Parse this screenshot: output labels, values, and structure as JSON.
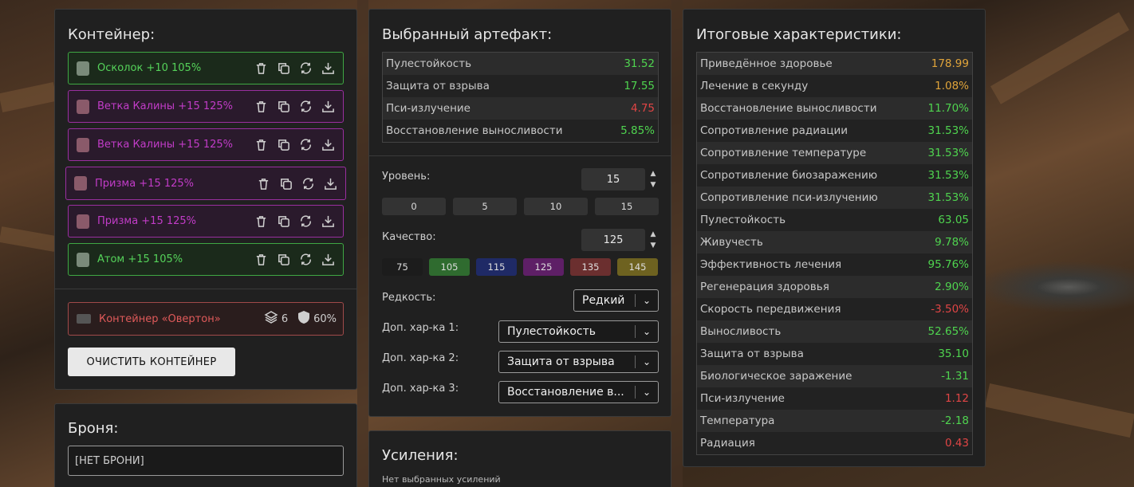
{
  "container": {
    "title": "Контейнер:",
    "items": [
      {
        "name": "Осколок +10 105%",
        "tier": "green"
      },
      {
        "name": "Ветка Калины +15 125%",
        "tier": "purple"
      },
      {
        "name": "Ветка Калины +15 125%",
        "tier": "purple"
      },
      {
        "name": "Призма +15 125%",
        "tier": "purple"
      },
      {
        "name": "Призма +15 125%",
        "tier": "purple"
      },
      {
        "name": "Атом +15 105%",
        "tier": "green"
      }
    ],
    "box": {
      "name": "Контейнер «Овертон»",
      "slots": "6",
      "protection": "60%"
    },
    "clear_label": "ОЧИСТИТЬ КОНТЕЙНЕР"
  },
  "armor": {
    "title": "Броня:",
    "value": "[НЕТ БРОНИ]"
  },
  "artifact": {
    "title": "Выбранный артефакт:",
    "stats": [
      {
        "label": "Пулестойкость",
        "value": "31.52",
        "color": "green"
      },
      {
        "label": "Защита от взрыва",
        "value": "17.55",
        "color": "green"
      },
      {
        "label": "Пси-излучение",
        "value": "4.75",
        "color": "red"
      },
      {
        "label": "Восстановление выносливости",
        "value": "5.85%",
        "color": "green"
      }
    ],
    "level_label": "Уровень:",
    "level_value": "15",
    "level_presets": [
      "0",
      "5",
      "10",
      "15"
    ],
    "quality_label": "Качество:",
    "quality_value": "125",
    "quality_presets": [
      {
        "label": "75",
        "color": "#1c1c1c"
      },
      {
        "label": "105",
        "color": "#2f6b2f"
      },
      {
        "label": "115",
        "color": "#1f2a66"
      },
      {
        "label": "125",
        "color": "#5e1f66"
      },
      {
        "label": "135",
        "color": "#6b2f2f"
      },
      {
        "label": "145",
        "color": "#6e6220"
      }
    ],
    "rarity_label": "Редкость:",
    "rarity_value": "Редкий",
    "extra1_label": "Доп. хар-ка 1:",
    "extra1_value": "Пулестойкость",
    "extra2_label": "Доп. хар-ка 2:",
    "extra2_value": "Защита от взрыва",
    "extra3_label": "Доп. хар-ка 3:",
    "extra3_value": "Восстановление в..."
  },
  "boosts": {
    "title": "Усиления:",
    "empty_text": "Нет выбранных усилений"
  },
  "totals": {
    "title": "Итоговые характеристики:",
    "stats": [
      {
        "label": "Приведённое здоровье",
        "value": "178.99",
        "color": "gold"
      },
      {
        "label": "Лечение в секунду",
        "value": "1.08%",
        "color": "gold"
      },
      {
        "label": "Восстановление выносливости",
        "value": "11.70%",
        "color": "green"
      },
      {
        "label": "Сопротивление радиации",
        "value": "31.53%",
        "color": "green"
      },
      {
        "label": "Сопротивление температуре",
        "value": "31.53%",
        "color": "green"
      },
      {
        "label": "Сопротивление биозаражению",
        "value": "31.53%",
        "color": "green"
      },
      {
        "label": "Сопротивление пси-излучению",
        "value": "31.53%",
        "color": "green"
      },
      {
        "label": "Пулестойкость",
        "value": "63.05",
        "color": "green"
      },
      {
        "label": "Живучесть",
        "value": "9.78%",
        "color": "green"
      },
      {
        "label": "Эффективность лечения",
        "value": "95.76%",
        "color": "green"
      },
      {
        "label": "Регенерация здоровья",
        "value": "2.90%",
        "color": "green"
      },
      {
        "label": "Скорость передвижения",
        "value": "-3.50%",
        "color": "red"
      },
      {
        "label": "Выносливость",
        "value": "52.65%",
        "color": "green"
      },
      {
        "label": "Защита от взрыва",
        "value": "35.10",
        "color": "green"
      },
      {
        "label": "Биологическое заражение",
        "value": "-1.31",
        "color": "green"
      },
      {
        "label": "Пси-излучение",
        "value": "1.12",
        "color": "red"
      },
      {
        "label": "Температура",
        "value": "-2.18",
        "color": "green"
      },
      {
        "label": "Радиация",
        "value": "0.43",
        "color": "red"
      }
    ]
  }
}
